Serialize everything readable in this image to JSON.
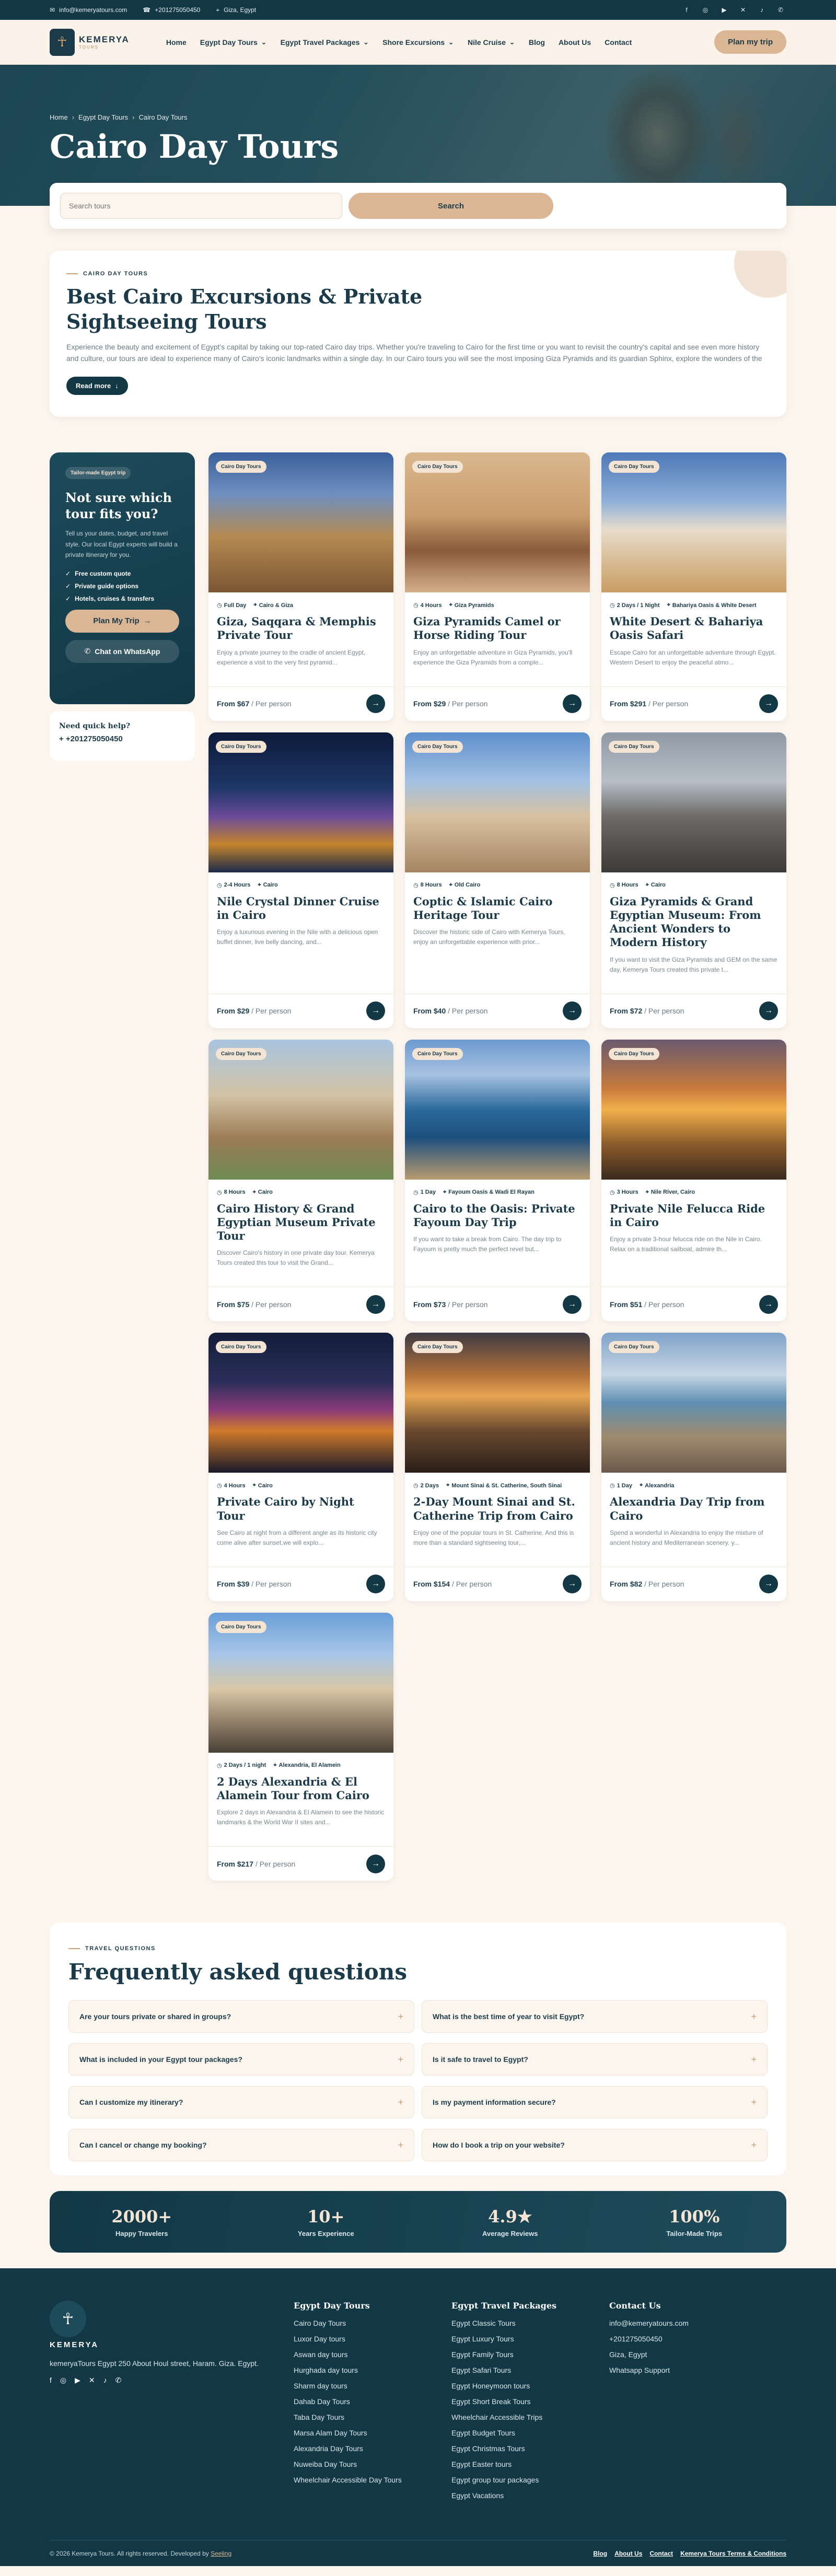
{
  "topbar": {
    "email": "info@kemeryatours.com",
    "phone": "+201275050450",
    "location": "Giza, Egypt"
  },
  "header": {
    "logo_text": "KEMERYA",
    "logo_sub": "TOURS",
    "nav": [
      {
        "label": "Home",
        "dropdown": false
      },
      {
        "label": "Egypt Day Tours",
        "dropdown": true
      },
      {
        "label": "Egypt Travel Packages",
        "dropdown": true
      },
      {
        "label": "Shore Excursions",
        "dropdown": true
      },
      {
        "label": "Nile Cruise",
        "dropdown": true
      },
      {
        "label": "Blog",
        "dropdown": false
      },
      {
        "label": "About Us",
        "dropdown": false
      },
      {
        "label": "Contact",
        "dropdown": false
      }
    ],
    "plan_label": "Plan my trip"
  },
  "hero": {
    "breadcrumb": [
      "Home",
      "Egypt Day Tours",
      "Cairo Day Tours"
    ],
    "title": "Cairo Day Tours"
  },
  "search": {
    "placeholder": "Search tours",
    "button": "Search"
  },
  "intro": {
    "eyebrow": "CAIRO DAY TOURS",
    "title": "Best Cairo Excursions & Private Sightseeing Tours",
    "text": "Experience the beauty and excitement of Egypt's capital by taking our top-rated Cairo day trips. Whether you're traveling to Cairo for the first time or you want to revisit the country's capital and see even more history and culture, our tours are ideal to experience many of Cairo's iconic landmarks within a single day. In our Cairo tours you will see the most imposing Giza Pyramids and its guardian Sphinx, explore the wonders of the Egyptian Museum and stroll through the famous Khan El Khalili bazaar.",
    "read_more": "Read more"
  },
  "sidebar": {
    "tag": "Tailor-made Egypt trip",
    "title": "Not sure which tour fits you?",
    "text": "Tell us your dates, budget, and travel style. Our local Egypt experts will build a private itinerary for you.",
    "list": [
      "Free custom quote",
      "Private guide options",
      "Hotels, cruises & transfers"
    ],
    "plan_btn": "Plan My Trip",
    "wa_btn": "Chat on WhatsApp",
    "help_title": "Need quick help?",
    "help_phone": "+ +201275050450"
  },
  "tours": [
    {
      "tag": "Cairo Day Tours",
      "duration": "Full Day",
      "location": "Cairo & Giza",
      "title": "Giza, Saqqara & Memphis Private Tour",
      "desc": "Enjoy a private journey to the cradle of ancient Egypt, experience a visit to the very first pyramid...",
      "price": "From $67",
      "per": "/ Per person",
      "img": "linear-gradient(180deg,#3a5f9a 0%,#6f8fbf 30%,#b58a52 60%,#7a5632 100%)"
    },
    {
      "tag": "Cairo Day Tours",
      "duration": "4 Hours",
      "location": "Giza Pyramids",
      "title": "Giza Pyramids Camel or Horse Riding Tour",
      "desc": "Enjoy an unforgettable adventure in Giza Pyramids, you'll experience the Giza Pyramids from a comple...",
      "price": "From $29",
      "per": "/ Per person",
      "img": "linear-gradient(180deg,#d9b78e 0%,#c99c6c 45%,#8a5a3a 70%,#d4b08a 100%)"
    },
    {
      "tag": "Cairo Day Tours",
      "duration": "2 Days / 1 Night",
      "location": "Bahariya Oasis & White Desert",
      "title": "White Desert & Bahariya Oasis Safari",
      "desc": "Escape Cairo for an unforgettable adventure through Egypt. Western Desert to enjoy the peaceful atmo...",
      "price": "From $291",
      "per": "/ Per person",
      "img": "linear-gradient(180deg,#4d79b8 0%,#8fb0d8 35%,#e7dccb 55%,#c99d63 100%)"
    },
    {
      "tag": "Cairo Day Tours",
      "duration": "2-4 Hours",
      "location": "Cairo",
      "title": "Nile Crystal Dinner Cruise in Cairo",
      "desc": "Enjoy a luxurious evening in the Nile with a delicious open buffet dinner, live belly dancing, and...",
      "price": "From $29",
      "per": "/ Per person",
      "img": "linear-gradient(180deg,#0d1a3a 0%,#1f3768 40%,#6a4a9a 60%,#c4842c 80%,#1a2a4a 100%)"
    },
    {
      "tag": "Cairo Day Tours",
      "duration": "8 Hours",
      "location": "Old Cairo",
      "title": "Coptic & Islamic Cairo Heritage Tour",
      "desc": "Discover the historic side of Cairo with Kemerya Tours, enjoy an unforgettable experience with prior...",
      "price": "From $40",
      "per": "/ Per person",
      "img": "linear-gradient(180deg,#5e8fcc 0%,#a3c1e3 35%,#d8c1a0 60%,#a58563 100%)"
    },
    {
      "tag": "Cairo Day Tours",
      "duration": "8 Hours",
      "location": "Cairo",
      "title": "Giza Pyramids & Grand Egyptian Museum: From Ancient Wonders to Modern History",
      "desc": "If you want to visit the Giza Pyramids and GEM on the same day, Kemerya Tours created this private t...",
      "price": "From $72",
      "pr": "",
      "per": "/ Per person",
      "img": "linear-gradient(180deg,#8f9aa6 0%,#b7bec6 35%,#6d6b67 60%,#3b3a38 100%)"
    },
    {
      "tag": "Cairo Day Tours",
      "duration": "8 Hours",
      "location": "Cairo",
      "title": "Cairo History & Grand Egyptian Museum Private Tour",
      "desc": "Discover Cairo's history in one private day tour. Kemerya Tours created this tour to visit the Grand...",
      "price": "From $75",
      "per": "/ Per person",
      "img": "linear-gradient(180deg,#a9c4df 0%,#d2c3a5 40%,#9c7c56 70%,#6e8a55 100%)"
    },
    {
      "tag": "Cairo Day Tours",
      "duration": "1 Day",
      "location": "Fayoum Oasis & Wadi El Rayan",
      "title": "Cairo to the Oasis: Private Fayoum Day Trip",
      "desc": "If you want to take a break from Cairo. The day trip to Fayoum is pretty much the perfect revel but...",
      "price": "From $73",
      "per": "/ Per person",
      "img": "linear-gradient(180deg,#6d9ad0 0%,#a6c2e0 25%,#2b6a9c 50%,#1d4f7e 70%,#b89b70 100%)"
    },
    {
      "tag": "Cairo Day Tours",
      "duration": "3 Hours",
      "location": "Nile River, Cairo",
      "title": "Private Nile Felucca Ride in Cairo",
      "desc": "Enjoy a private 3-hour felucca ride on the Nile in Cairo. Relax on a traditional sailboat, admire th...",
      "price": "From $51",
      "per": "/ Per person",
      "img": "linear-gradient(180deg,#6a5a6e 0%,#c77a3c 35%,#f2b04a 50%,#8a5a2a 75%,#3a2a1e 100%)"
    },
    {
      "tag": "Cairo Day Tours",
      "duration": "4 Hours",
      "location": "Cairo",
      "title": "Private Cairo by Night Tour",
      "desc": "See Cairo at night from a different angle as its historic city come alive after sunset.we will explo...",
      "price": "From $39",
      "per": "/ Per person",
      "img": "linear-gradient(180deg,#141d3a 0%,#2a2f5a 35%,#8a3a7a 55%,#d07a2a 70%,#1a1a2a 100%)"
    },
    {
      "tag": "Cairo Day Tours",
      "duration": "2 Days",
      "location": "Mount Sinai & St. Catherine, South Sinai",
      "title": "2-Day Mount Sinai and St. Catherine Trip from Cairo",
      "desc": "Enjoy one of the popular tours in St. Catherine. And this is more than a standard sightseeing tour,...",
      "price": "From $154",
      "per": "/ Per person",
      "img": "linear-gradient(180deg,#3e3a44 0%,#b0713a 30%,#e6a452 45%,#6a4a30 70%,#2a1e18 100%)"
    },
    {
      "tag": "Cairo Day Tours",
      "duration": "1 Day",
      "location": "Alexandria",
      "title": "Alexandria Day Trip from Cairo",
      "desc": "Spend a wonderful in Alexandria to enjoy the mixture of ancient history and Mediterranean scenery. y...",
      "price": "From $82",
      "per": "/ Per person",
      "img": "linear-gradient(180deg,#7fa3c9 0%,#c7d6e4 30%,#5d8fb3 50%,#a08a6e 75%,#6a5a4a 100%)"
    },
    {
      "tag": "Cairo Day Tours",
      "duration": "2 Days / 1 night",
      "location": "Alexandria, El Alamein",
      "title": "2 Days Alexandria & El Alamein Tour from Cairo",
      "desc": "Explore 2 days in Alexandria & El Alamein to see the historic landmarks & the World War II sites and...",
      "price": "From $217",
      "per": "/ Per person",
      "img": "linear-gradient(180deg,#6a9fd8 0%,#a8c6e8 30%,#d8c6a4 55%,#8a7a64 80%,#4a4036 100%)"
    }
  ],
  "faq": {
    "eyebrow": "TRAVEL QUESTIONS",
    "title": "Frequently asked questions",
    "items": [
      "Are your tours private or shared in groups?",
      "What is the best time of year to visit Egypt?",
      "What is included in your Egypt tour packages?",
      "Is it safe to travel to Egypt?",
      "Can I customize my itinerary?",
      "Is my payment information secure?",
      "Can I cancel or change my booking?",
      "How do I book a trip on your website?"
    ]
  },
  "stats": [
    {
      "num": "2000+",
      "label": "Happy Travelers"
    },
    {
      "num": "10+",
      "label": "Years Experience"
    },
    {
      "num": "4.9★",
      "label": "Average Reviews"
    },
    {
      "num": "100%",
      "label": "Tailor-Made Trips"
    }
  ],
  "footer": {
    "logo_text": "KEMERYA",
    "logo_sub": "TOURS",
    "address": "kemeryaTours Egypt 250 About Houl street, Haram. Giza. Egypt.",
    "cols": [
      {
        "title": "Egypt Day Tours",
        "links": [
          "Cairo Day Tours",
          "Luxor Day tours",
          "Aswan day tours",
          "Hurghada day tours",
          "Sharm day tours",
          "Dahab Day Tours",
          "Taba Day Tours",
          "Marsa Alam Day Tours",
          "Alexandria Day Tours",
          "Nuweiba Day Tours",
          "Wheelchair Accessible Day Tours"
        ]
      },
      {
        "title": "Egypt Travel Packages",
        "links": [
          "Egypt Classic Tours",
          "Egypt Luxury Tours",
          "Egypt Family Tours",
          "Egypt Safari Tours",
          "Egypt Honeymoon tours",
          "Egypt Short Break Tours",
          "Wheelchair Accessible Trips",
          "Egypt Budget Tours",
          "Egypt Christmas Tours",
          "Egypt Easter tours",
          "Egypt group tour packages",
          "Egypt Vacations"
        ]
      },
      {
        "title": "Contact Us",
        "links": [
          "info@kemeryatours.com",
          "+201275050450",
          "Giza, Egypt",
          "Whatsapp Support"
        ]
      }
    ],
    "copyright": "© 2026 Kemerya Tours. All rights reserved. Developed by",
    "developer": "Seeling",
    "bottom_links": [
      "Blog",
      "About Us",
      "Contact",
      "Kemerya Tours Terms & Conditions"
    ]
  },
  "colors": {
    "primary": "#123846",
    "accent": "#dbb695",
    "background": "#fbf5ee"
  }
}
